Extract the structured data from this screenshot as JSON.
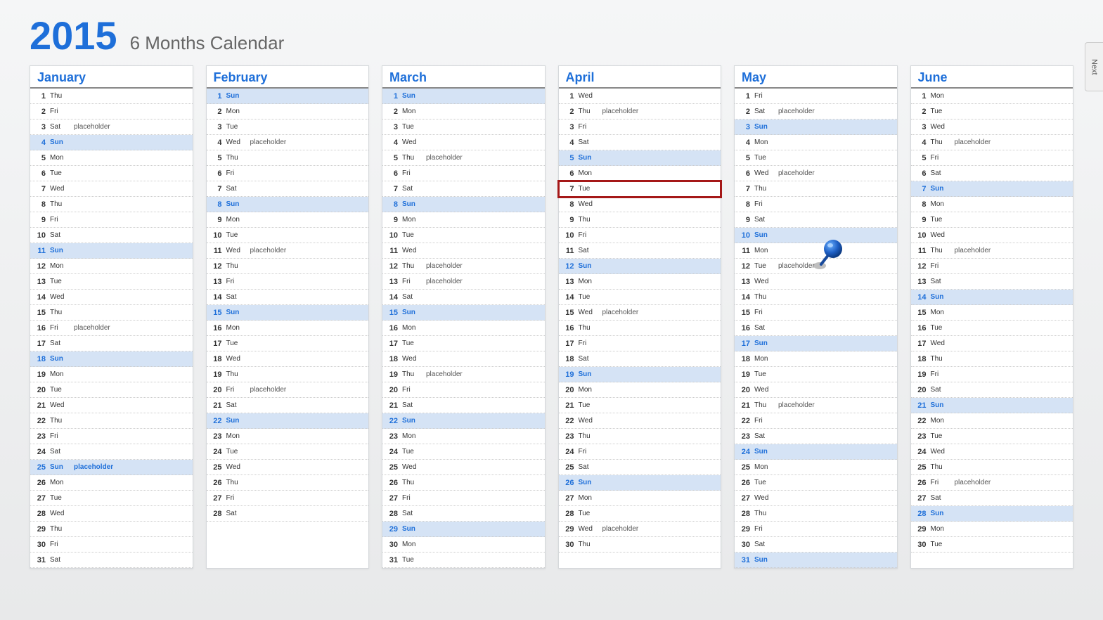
{
  "header": {
    "year": "2015",
    "subtitle": "6 Months Calendar"
  },
  "next_label": "Next",
  "placeholder_text": "placeholder",
  "months": [
    {
      "name": "January",
      "days": [
        {
          "n": 1,
          "d": "Thu"
        },
        {
          "n": 2,
          "d": "Fri"
        },
        {
          "n": 3,
          "d": "Sat",
          "note": true
        },
        {
          "n": 4,
          "d": "Sun",
          "sun": true
        },
        {
          "n": 5,
          "d": "Mon"
        },
        {
          "n": 6,
          "d": "Tue"
        },
        {
          "n": 7,
          "d": "Wed"
        },
        {
          "n": 8,
          "d": "Thu"
        },
        {
          "n": 9,
          "d": "Fri"
        },
        {
          "n": 10,
          "d": "Sat"
        },
        {
          "n": 11,
          "d": "Sun",
          "sun": true
        },
        {
          "n": 12,
          "d": "Mon"
        },
        {
          "n": 13,
          "d": "Tue"
        },
        {
          "n": 14,
          "d": "Wed"
        },
        {
          "n": 15,
          "d": "Thu"
        },
        {
          "n": 16,
          "d": "Fri",
          "note": true
        },
        {
          "n": 17,
          "d": "Sat"
        },
        {
          "n": 18,
          "d": "Sun",
          "sun": true
        },
        {
          "n": 19,
          "d": "Mon"
        },
        {
          "n": 20,
          "d": "Tue"
        },
        {
          "n": 21,
          "d": "Wed"
        },
        {
          "n": 22,
          "d": "Thu"
        },
        {
          "n": 23,
          "d": "Fri"
        },
        {
          "n": 24,
          "d": "Sat"
        },
        {
          "n": 25,
          "d": "Sun",
          "sun": true,
          "note": true
        },
        {
          "n": 26,
          "d": "Mon"
        },
        {
          "n": 27,
          "d": "Tue"
        },
        {
          "n": 28,
          "d": "Wed"
        },
        {
          "n": 29,
          "d": "Thu"
        },
        {
          "n": 30,
          "d": "Fri"
        },
        {
          "n": 31,
          "d": "Sat"
        }
      ]
    },
    {
      "name": "February",
      "days": [
        {
          "n": 1,
          "d": "Sun",
          "sun": true
        },
        {
          "n": 2,
          "d": "Mon"
        },
        {
          "n": 3,
          "d": "Tue"
        },
        {
          "n": 4,
          "d": "Wed",
          "note": true
        },
        {
          "n": 5,
          "d": "Thu"
        },
        {
          "n": 6,
          "d": "Fri"
        },
        {
          "n": 7,
          "d": "Sat"
        },
        {
          "n": 8,
          "d": "Sun",
          "sun": true
        },
        {
          "n": 9,
          "d": "Mon"
        },
        {
          "n": 10,
          "d": "Tue"
        },
        {
          "n": 11,
          "d": "Wed",
          "note": true
        },
        {
          "n": 12,
          "d": "Thu"
        },
        {
          "n": 13,
          "d": "Fri"
        },
        {
          "n": 14,
          "d": "Sat"
        },
        {
          "n": 15,
          "d": "Sun",
          "sun": true
        },
        {
          "n": 16,
          "d": "Mon"
        },
        {
          "n": 17,
          "d": "Tue"
        },
        {
          "n": 18,
          "d": "Wed"
        },
        {
          "n": 19,
          "d": "Thu"
        },
        {
          "n": 20,
          "d": "Fri",
          "note": true
        },
        {
          "n": 21,
          "d": "Sat"
        },
        {
          "n": 22,
          "d": "Sun",
          "sun": true
        },
        {
          "n": 23,
          "d": "Mon"
        },
        {
          "n": 24,
          "d": "Tue"
        },
        {
          "n": 25,
          "d": "Wed"
        },
        {
          "n": 26,
          "d": "Thu"
        },
        {
          "n": 27,
          "d": "Fri"
        },
        {
          "n": 28,
          "d": "Sat"
        }
      ]
    },
    {
      "name": "March",
      "days": [
        {
          "n": 1,
          "d": "Sun",
          "sun": true
        },
        {
          "n": 2,
          "d": "Mon"
        },
        {
          "n": 3,
          "d": "Tue"
        },
        {
          "n": 4,
          "d": "Wed"
        },
        {
          "n": 5,
          "d": "Thu",
          "note": true
        },
        {
          "n": 6,
          "d": "Fri"
        },
        {
          "n": 7,
          "d": "Sat"
        },
        {
          "n": 8,
          "d": "Sun",
          "sun": true
        },
        {
          "n": 9,
          "d": "Mon"
        },
        {
          "n": 10,
          "d": "Tue"
        },
        {
          "n": 11,
          "d": "Wed"
        },
        {
          "n": 12,
          "d": "Thu",
          "note": true
        },
        {
          "n": 13,
          "d": "Fri",
          "note": true
        },
        {
          "n": 14,
          "d": "Sat"
        },
        {
          "n": 15,
          "d": "Sun",
          "sun": true
        },
        {
          "n": 16,
          "d": "Mon"
        },
        {
          "n": 17,
          "d": "Tue"
        },
        {
          "n": 18,
          "d": "Wed"
        },
        {
          "n": 19,
          "d": "Thu",
          "note": true
        },
        {
          "n": 20,
          "d": "Fri"
        },
        {
          "n": 21,
          "d": "Sat"
        },
        {
          "n": 22,
          "d": "Sun",
          "sun": true
        },
        {
          "n": 23,
          "d": "Mon"
        },
        {
          "n": 24,
          "d": "Tue"
        },
        {
          "n": 25,
          "d": "Wed"
        },
        {
          "n": 26,
          "d": "Thu"
        },
        {
          "n": 27,
          "d": "Fri"
        },
        {
          "n": 28,
          "d": "Sat"
        },
        {
          "n": 29,
          "d": "Sun",
          "sun": true
        },
        {
          "n": 30,
          "d": "Mon"
        },
        {
          "n": 31,
          "d": "Tue"
        }
      ]
    },
    {
      "name": "April",
      "days": [
        {
          "n": 1,
          "d": "Wed"
        },
        {
          "n": 2,
          "d": "Thu",
          "note": true
        },
        {
          "n": 3,
          "d": "Fri"
        },
        {
          "n": 4,
          "d": "Sat"
        },
        {
          "n": 5,
          "d": "Sun",
          "sun": true
        },
        {
          "n": 6,
          "d": "Mon"
        },
        {
          "n": 7,
          "d": "Tue",
          "highlight": true
        },
        {
          "n": 8,
          "d": "Wed"
        },
        {
          "n": 9,
          "d": "Thu"
        },
        {
          "n": 10,
          "d": "Fri"
        },
        {
          "n": 11,
          "d": "Sat"
        },
        {
          "n": 12,
          "d": "Sun",
          "sun": true
        },
        {
          "n": 13,
          "d": "Mon"
        },
        {
          "n": 14,
          "d": "Tue"
        },
        {
          "n": 15,
          "d": "Wed",
          "note": true
        },
        {
          "n": 16,
          "d": "Thu"
        },
        {
          "n": 17,
          "d": "Fri"
        },
        {
          "n": 18,
          "d": "Sat"
        },
        {
          "n": 19,
          "d": "Sun",
          "sun": true
        },
        {
          "n": 20,
          "d": "Mon"
        },
        {
          "n": 21,
          "d": "Tue"
        },
        {
          "n": 22,
          "d": "Wed"
        },
        {
          "n": 23,
          "d": "Thu"
        },
        {
          "n": 24,
          "d": "Fri"
        },
        {
          "n": 25,
          "d": "Sat"
        },
        {
          "n": 26,
          "d": "Sun",
          "sun": true
        },
        {
          "n": 27,
          "d": "Mon"
        },
        {
          "n": 28,
          "d": "Tue"
        },
        {
          "n": 29,
          "d": "Wed",
          "note": true
        },
        {
          "n": 30,
          "d": "Thu"
        }
      ]
    },
    {
      "name": "May",
      "days": [
        {
          "n": 1,
          "d": "Fri"
        },
        {
          "n": 2,
          "d": "Sat",
          "note": true
        },
        {
          "n": 3,
          "d": "Sun",
          "sun": true
        },
        {
          "n": 4,
          "d": "Mon"
        },
        {
          "n": 5,
          "d": "Tue"
        },
        {
          "n": 6,
          "d": "Wed",
          "note": true
        },
        {
          "n": 7,
          "d": "Thu"
        },
        {
          "n": 8,
          "d": "Fri"
        },
        {
          "n": 9,
          "d": "Sat"
        },
        {
          "n": 10,
          "d": "Sun",
          "sun": true
        },
        {
          "n": 11,
          "d": "Mon"
        },
        {
          "n": 12,
          "d": "Tue",
          "note": true
        },
        {
          "n": 13,
          "d": "Wed"
        },
        {
          "n": 14,
          "d": "Thu"
        },
        {
          "n": 15,
          "d": "Fri"
        },
        {
          "n": 16,
          "d": "Sat"
        },
        {
          "n": 17,
          "d": "Sun",
          "sun": true
        },
        {
          "n": 18,
          "d": "Mon"
        },
        {
          "n": 19,
          "d": "Tue"
        },
        {
          "n": 20,
          "d": "Wed"
        },
        {
          "n": 21,
          "d": "Thu",
          "note": true
        },
        {
          "n": 22,
          "d": "Fri"
        },
        {
          "n": 23,
          "d": "Sat"
        },
        {
          "n": 24,
          "d": "Sun",
          "sun": true
        },
        {
          "n": 25,
          "d": "Mon"
        },
        {
          "n": 26,
          "d": "Tue"
        },
        {
          "n": 27,
          "d": "Wed"
        },
        {
          "n": 28,
          "d": "Thu"
        },
        {
          "n": 29,
          "d": "Fri"
        },
        {
          "n": 30,
          "d": "Sat"
        },
        {
          "n": 31,
          "d": "Sun",
          "sun": true
        }
      ]
    },
    {
      "name": "June",
      "days": [
        {
          "n": 1,
          "d": "Mon"
        },
        {
          "n": 2,
          "d": "Tue"
        },
        {
          "n": 3,
          "d": "Wed"
        },
        {
          "n": 4,
          "d": "Thu",
          "note": true
        },
        {
          "n": 5,
          "d": "Fri"
        },
        {
          "n": 6,
          "d": "Sat"
        },
        {
          "n": 7,
          "d": "Sun",
          "sun": true
        },
        {
          "n": 8,
          "d": "Mon"
        },
        {
          "n": 9,
          "d": "Tue"
        },
        {
          "n": 10,
          "d": "Wed"
        },
        {
          "n": 11,
          "d": "Thu",
          "note": true
        },
        {
          "n": 12,
          "d": "Fri"
        },
        {
          "n": 13,
          "d": "Sat"
        },
        {
          "n": 14,
          "d": "Sun",
          "sun": true
        },
        {
          "n": 15,
          "d": "Mon"
        },
        {
          "n": 16,
          "d": "Tue"
        },
        {
          "n": 17,
          "d": "Wed"
        },
        {
          "n": 18,
          "d": "Thu"
        },
        {
          "n": 19,
          "d": "Fri"
        },
        {
          "n": 20,
          "d": "Sat"
        },
        {
          "n": 21,
          "d": "Sun",
          "sun": true
        },
        {
          "n": 22,
          "d": "Mon"
        },
        {
          "n": 23,
          "d": "Tue"
        },
        {
          "n": 24,
          "d": "Wed"
        },
        {
          "n": 25,
          "d": "Thu"
        },
        {
          "n": 26,
          "d": "Fri",
          "note": true
        },
        {
          "n": 27,
          "d": "Sat"
        },
        {
          "n": 28,
          "d": "Sun",
          "sun": true
        },
        {
          "n": 29,
          "d": "Mon"
        },
        {
          "n": 30,
          "d": "Tue"
        }
      ]
    }
  ]
}
